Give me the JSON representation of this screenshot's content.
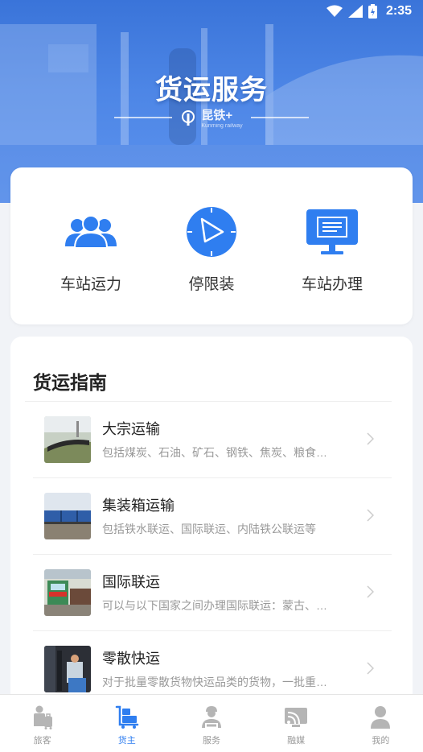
{
  "status_bar": {
    "time": "2:35"
  },
  "hero": {
    "title": "货运服务",
    "brand_name": "昆铁",
    "brand_suffix": "+",
    "brand_subtitle": "Kunming railway"
  },
  "quick_actions": [
    {
      "label": "车站运力",
      "icon": "people-group-icon"
    },
    {
      "label": "停限装",
      "icon": "compass-arrow-icon"
    },
    {
      "label": "车站办理",
      "icon": "monitor-icon"
    }
  ],
  "guide": {
    "title": "货运指南",
    "items": [
      {
        "name": "大宗运输",
        "desc": "包括煤炭、石油、矿石、钢铁、焦炭、粮食…",
        "thumb": "coal-train-photo"
      },
      {
        "name": "集装箱运输",
        "desc": "包括铁水联运、国际联运、内陆铁公联运等",
        "thumb": "container-train-photo"
      },
      {
        "name": "国际联运",
        "desc": "可以与以下国家之间办理国际联运：蒙古、…",
        "thumb": "international-train-photo"
      },
      {
        "name": "零散快运",
        "desc": "对于批量零散货物快运品类的货物，一批重…",
        "thumb": "parcel-freight-photo"
      }
    ]
  },
  "bottom_nav": [
    {
      "label": "旅客",
      "icon": "passenger-icon",
      "active": false
    },
    {
      "label": "货主",
      "icon": "cargo-cart-icon",
      "active": true
    },
    {
      "label": "服务",
      "icon": "service-person-icon",
      "active": false
    },
    {
      "label": "融媒",
      "icon": "media-cast-icon",
      "active": false
    },
    {
      "label": "我的",
      "icon": "profile-icon",
      "active": false
    }
  ],
  "colors": {
    "primary": "#2f7ef0",
    "hero_top": "#3a74d9",
    "nav_inactive": "#9a9a9a",
    "background": "#f1f3f7"
  }
}
